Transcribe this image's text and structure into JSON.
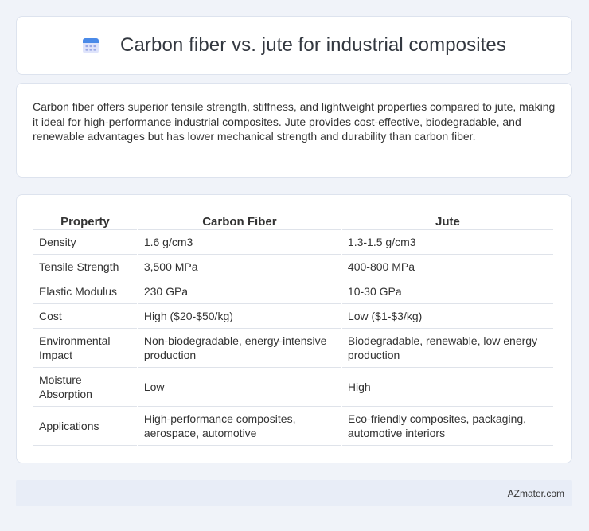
{
  "header": {
    "title": "Carbon fiber vs. jute for industrial composites",
    "icon": "calendar-icon"
  },
  "summary": {
    "text": "Carbon fiber offers superior tensile strength, stiffness, and lightweight properties compared to jute, making it ideal for high-performance industrial composites. Jute provides cost-effective, biodegradable, and renewable advantages but has lower mechanical strength and durability than carbon fiber."
  },
  "table": {
    "headers": [
      "Property",
      "Carbon Fiber",
      "Jute"
    ],
    "rows": [
      [
        "Density",
        "1.6 g/cm3",
        "1.3-1.5 g/cm3"
      ],
      [
        "Tensile Strength",
        "3,500 MPa",
        "400-800 MPa"
      ],
      [
        "Elastic Modulus",
        "230 GPa",
        "10-30 GPa"
      ],
      [
        "Cost",
        "High ($20-$50/kg)",
        "Low ($1-$3/kg)"
      ],
      [
        "Environmental Impact",
        "Non-biodegradable, energy-intensive production",
        "Biodegradable, renewable, low energy production"
      ],
      [
        "Moisture Absorption",
        "Low",
        "High"
      ],
      [
        "Applications",
        "High-performance composites, aerospace, automotive",
        "Eco-friendly composites, packaging, automotive interiors"
      ]
    ]
  },
  "footer": {
    "site": "AZmater.com"
  },
  "colors": {
    "background": "#f0f3f9",
    "card": "#ffffff",
    "footer": "#e8edf7",
    "icon_blue": "#4a8ae8",
    "icon_light": "#b9c6f0"
  }
}
